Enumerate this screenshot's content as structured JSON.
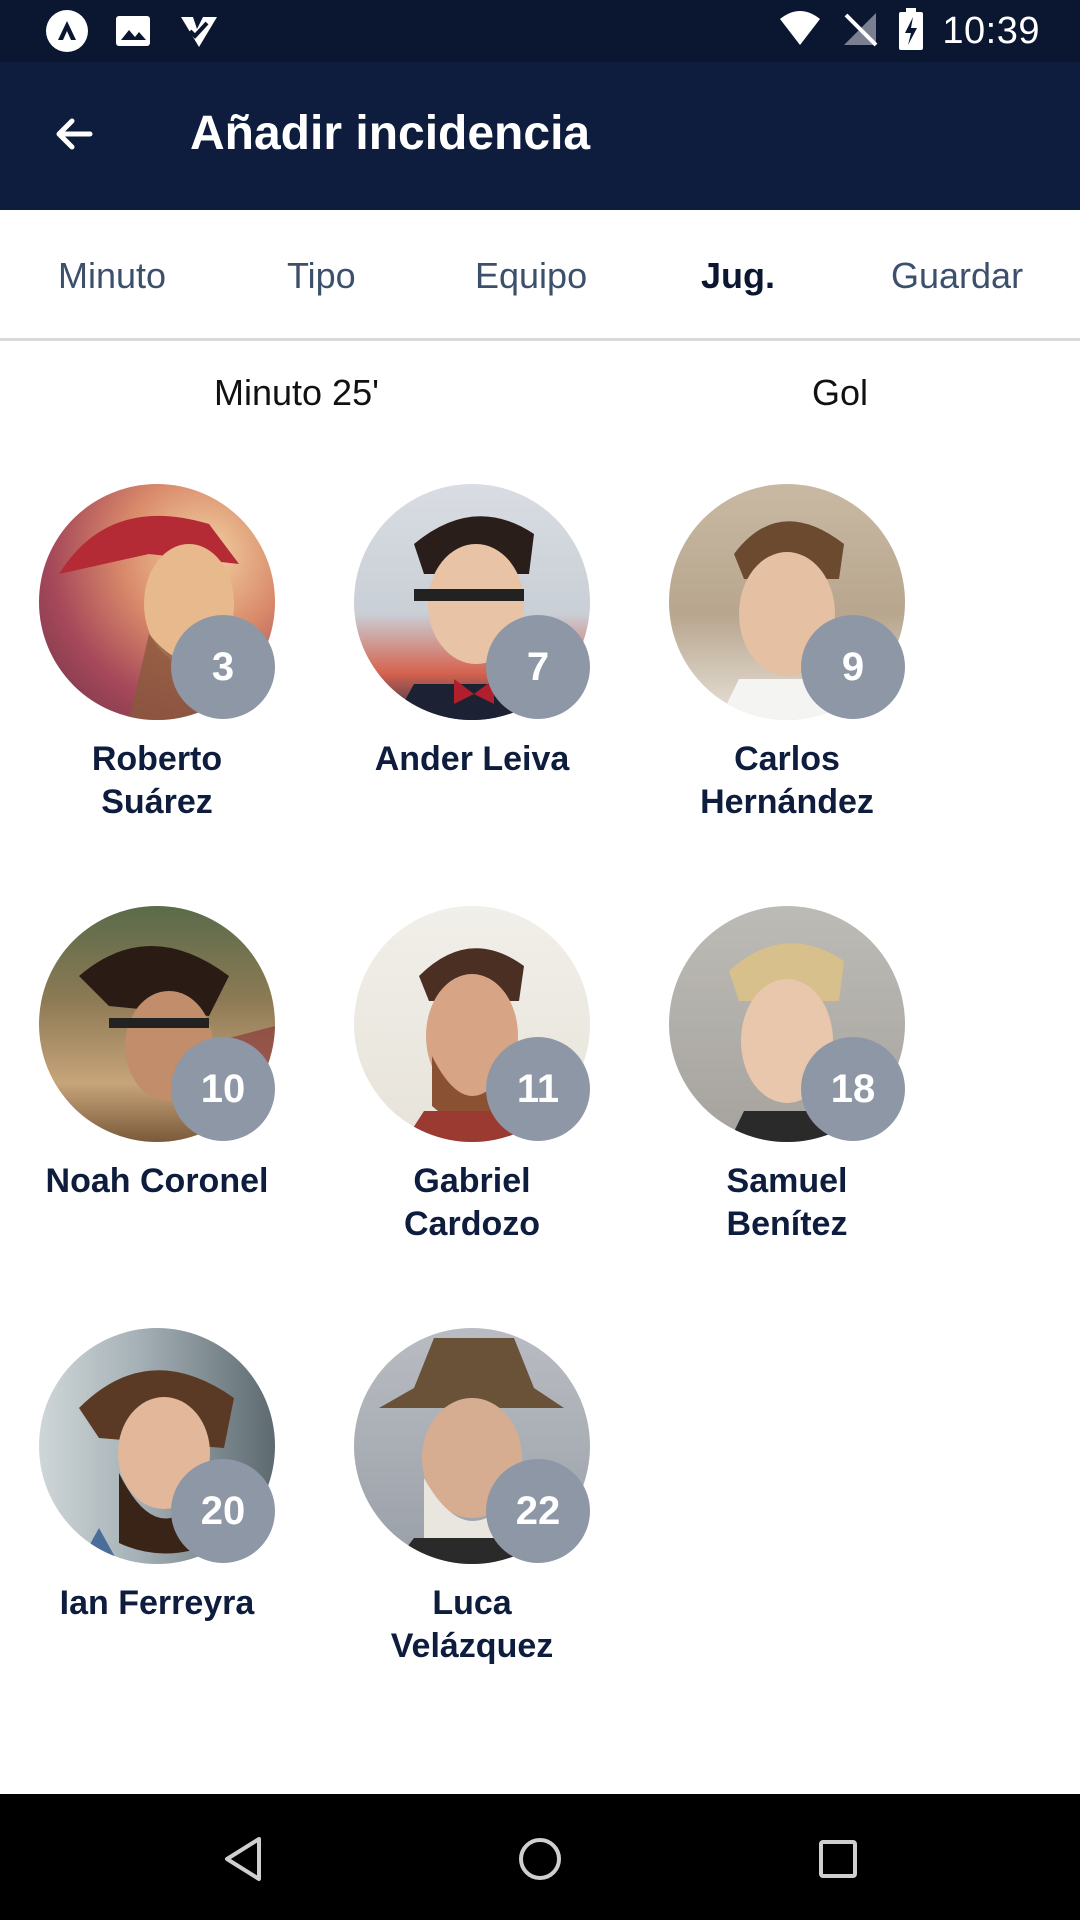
{
  "status_bar": {
    "time": "10:39",
    "left_icons": [
      "app-logo-icon",
      "image-icon",
      "checklist-icon"
    ],
    "right_icons": [
      "wifi-icon",
      "no-signal-icon",
      "battery-charging-icon"
    ]
  },
  "app_bar": {
    "title": "Añadir incidencia",
    "back_icon": "arrow-back-icon"
  },
  "steps": [
    {
      "label": "Minuto",
      "active": false
    },
    {
      "label": "Tipo",
      "active": false
    },
    {
      "label": "Equipo",
      "active": false
    },
    {
      "label": "Jug.",
      "active": true
    },
    {
      "label": "Guardar",
      "active": false
    }
  ],
  "summary": {
    "minute": "Minuto 25'",
    "type": "Gol"
  },
  "players": [
    {
      "number": "3",
      "name_line1": "Roberto",
      "name_line2": "Suárez"
    },
    {
      "number": "7",
      "name_line1": "Ander Leiva",
      "name_line2": ""
    },
    {
      "number": "9",
      "name_line1": "Carlos",
      "name_line2": "Hernández"
    },
    {
      "number": "10",
      "name_line1": "Noah Coronel",
      "name_line2": ""
    },
    {
      "number": "11",
      "name_line1": "Gabriel",
      "name_line2": "Cardozo"
    },
    {
      "number": "18",
      "name_line1": "Samuel",
      "name_line2": "Benítez"
    },
    {
      "number": "20",
      "name_line1": "Ian Ferreyra",
      "name_line2": ""
    },
    {
      "number": "22",
      "name_line1": "Luca",
      "name_line2": "Velázquez"
    }
  ],
  "colors": {
    "primary_dark": "#0e1d3d",
    "status_bar": "#0b1630",
    "badge": "#8e97a6"
  },
  "nav_bar": {
    "icons": [
      "back-triangle-icon",
      "home-circle-icon",
      "recents-square-icon"
    ]
  }
}
